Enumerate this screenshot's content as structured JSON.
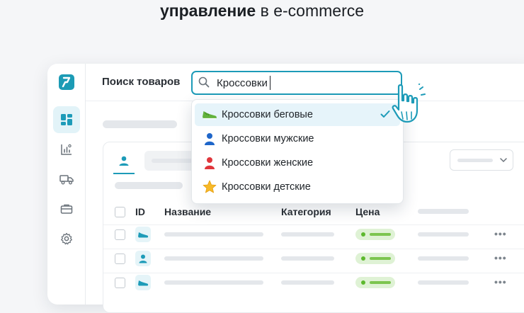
{
  "headline": {
    "bold": "управление",
    "rest": " в e-commerce"
  },
  "colors": {
    "accent": "#1d9bb8",
    "active_bg": "#e2f3f8",
    "price_green": "#5db92e"
  },
  "sidebar": {
    "logo_icon": "brand-logo-icon",
    "items": [
      {
        "icon": "dashboard-icon",
        "active": true
      },
      {
        "icon": "analytics-icon",
        "active": false
      },
      {
        "icon": "truck-icon",
        "active": false
      },
      {
        "icon": "briefcase-icon",
        "active": false
      },
      {
        "icon": "gear-icon",
        "active": false
      }
    ]
  },
  "search": {
    "label": "Поиск товаров",
    "value": "Кроссовки",
    "icon": "search-icon"
  },
  "dropdown": {
    "items": [
      {
        "label": "Кроссовки беговые",
        "icon": "sneaker-icon",
        "selected": true
      },
      {
        "label": "Кроссовки мужские",
        "icon": "person-blue-icon",
        "selected": false
      },
      {
        "label": "Кроссовки женские",
        "icon": "person-red-icon",
        "selected": false
      },
      {
        "label": "Кроссовки детские",
        "icon": "star-icon",
        "selected": false
      }
    ]
  },
  "table": {
    "headers": {
      "id": "ID",
      "name": "Название",
      "category": "Категория",
      "price": "Цена"
    },
    "rows": [
      {
        "icon": "sneaker-icon"
      },
      {
        "icon": "person-icon"
      },
      {
        "icon": "sneaker-icon"
      }
    ],
    "more_label": "•••"
  }
}
